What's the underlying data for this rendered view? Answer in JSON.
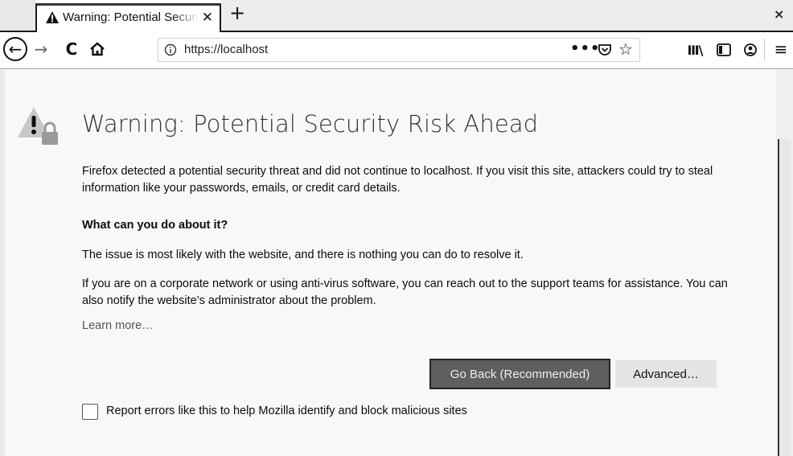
{
  "tabs": [
    {
      "title": "Warning: Potential Security Risk Ahead",
      "close_icon": "close-icon",
      "icon": "warning-triangle-icon"
    }
  ],
  "tabstrip": {
    "new_tab_label": "+",
    "window_close_label": "×"
  },
  "navbar": {
    "back_glyph": "←",
    "forward_glyph": "→",
    "reload_glyph": "C",
    "url": "https://localhost",
    "page_actions_glyph": "•••",
    "bookmark_glyph": "☆",
    "library_glyph": "Ⅲ\\",
    "menu_glyph": "≡"
  },
  "page": {
    "title": "Warning: Potential Security Risk Ahead",
    "intro": "Firefox detected a potential security threat and did not continue to localhost. If you visit this site, attackers could try to steal information like your passwords, emails, or credit card details.",
    "what_heading": "What can you do about it?",
    "issue_text": "The issue is most likely with the website, and there is nothing you can do to resolve it.",
    "corporate_text": "If you are on a corporate network or using anti-virus software, you can reach out to the support teams for assistance. You can also notify the website’s administrator about the problem.",
    "learn_more": "Learn more…",
    "go_back_label": "Go Back (Recommended)",
    "advanced_label": "Advanced…",
    "report_label": "Report errors like this to help Mozilla identify and block malicious sites",
    "report_checked": false
  },
  "colors": {
    "primary_button": "#5f5f5f",
    "secondary_button": "#e4e4e4",
    "page_background": "#f8f8f8"
  }
}
